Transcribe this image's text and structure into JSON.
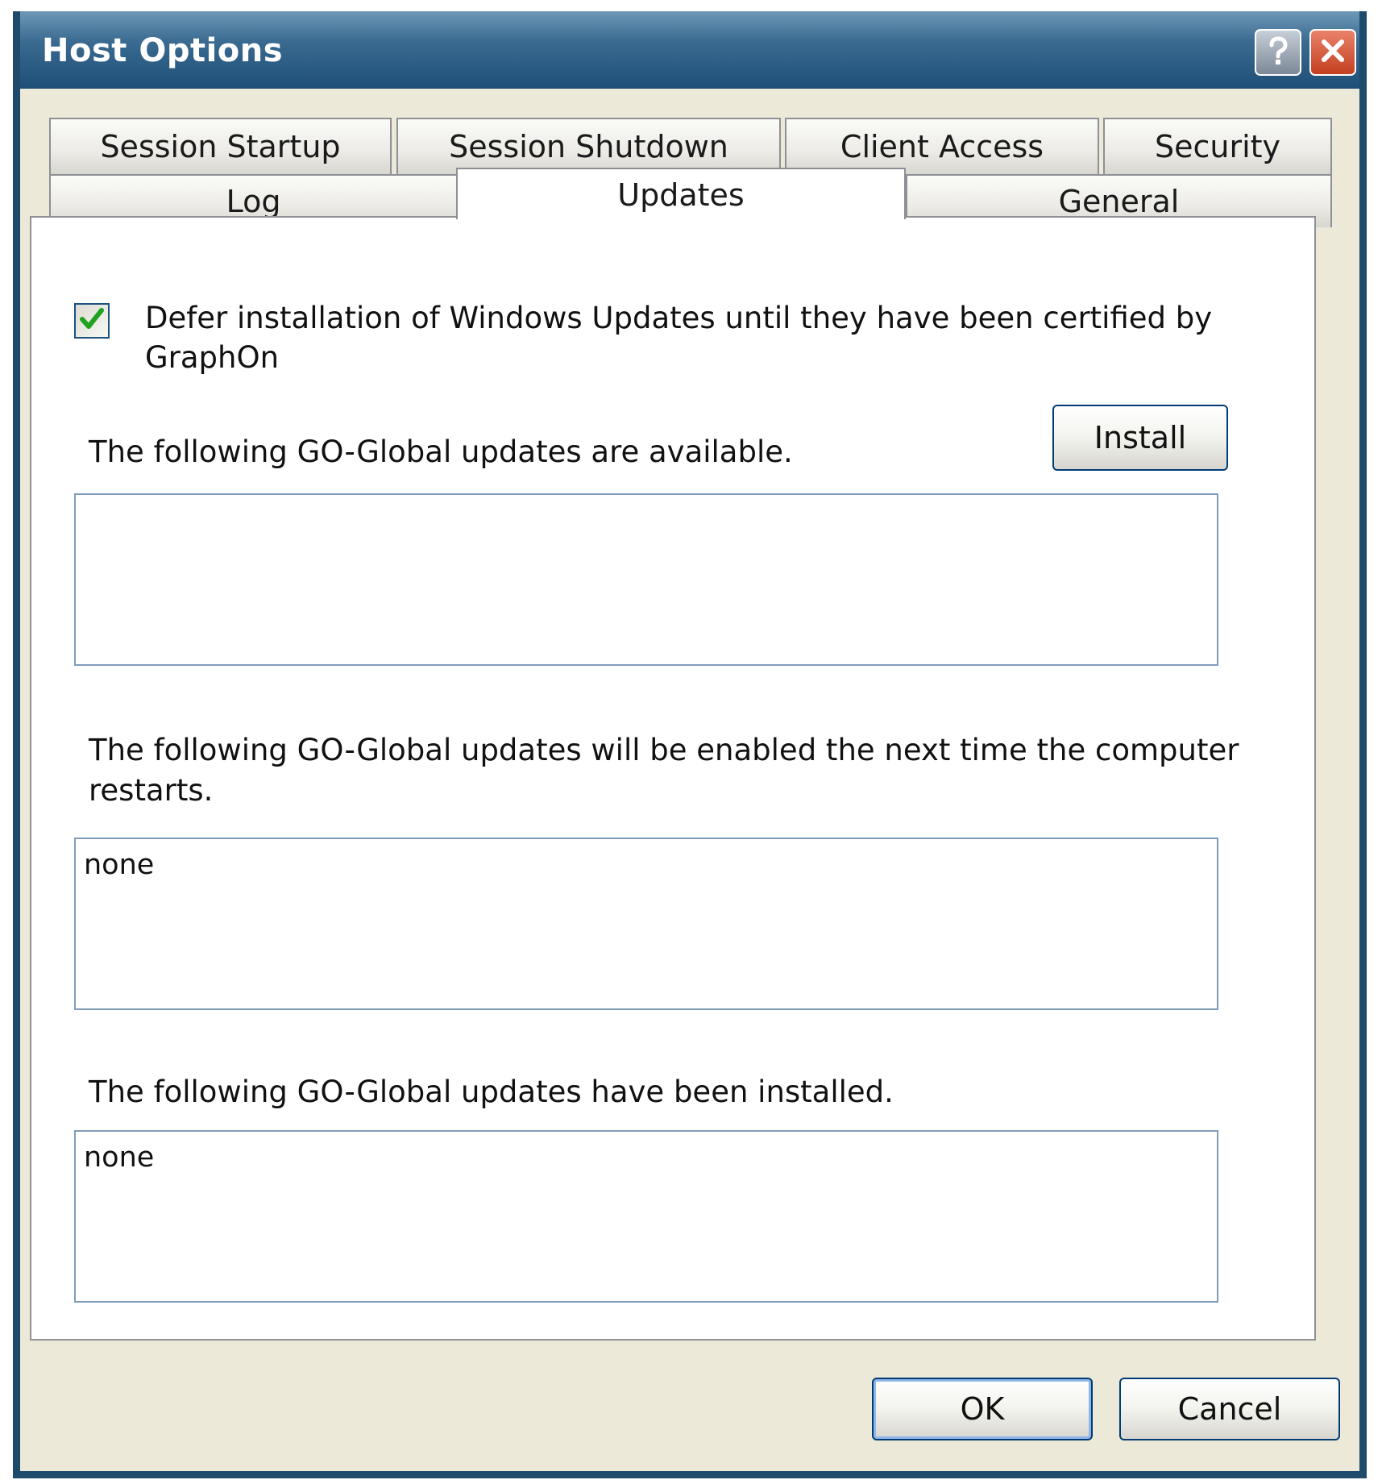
{
  "window": {
    "title": "Host Options"
  },
  "tabs": {
    "row_top": [
      "Session Startup",
      "Session Shutdown",
      "Client Access",
      "Security"
    ],
    "row_bottom": [
      "Log",
      "Updates",
      "General"
    ],
    "active": "Updates"
  },
  "updates": {
    "defer_checkbox": {
      "checked": true,
      "label_line1": "Defer installation of Windows Updates until they have been certified by",
      "label_line2": "GraphOn"
    },
    "available_label": "The following GO-Global updates are available.",
    "install_button": "Install",
    "available_list": "",
    "pending_label_line1": "The following GO-Global updates will be enabled the next time the computer",
    "pending_label_line2": "restarts.",
    "pending_list": "none",
    "installed_label": "The following GO-Global updates have been installed.",
    "installed_list": "none"
  },
  "footer": {
    "ok_button": "OK",
    "cancel_button": "Cancel"
  },
  "icons": {
    "help": "help-icon",
    "close": "close-icon",
    "check": "checkmark-icon"
  },
  "colors": {
    "titlebar": "#1e4f77",
    "dialog_bg": "#ece9d8",
    "close_button": "#c2401f",
    "default_button_focus": "#8fb6e8"
  }
}
